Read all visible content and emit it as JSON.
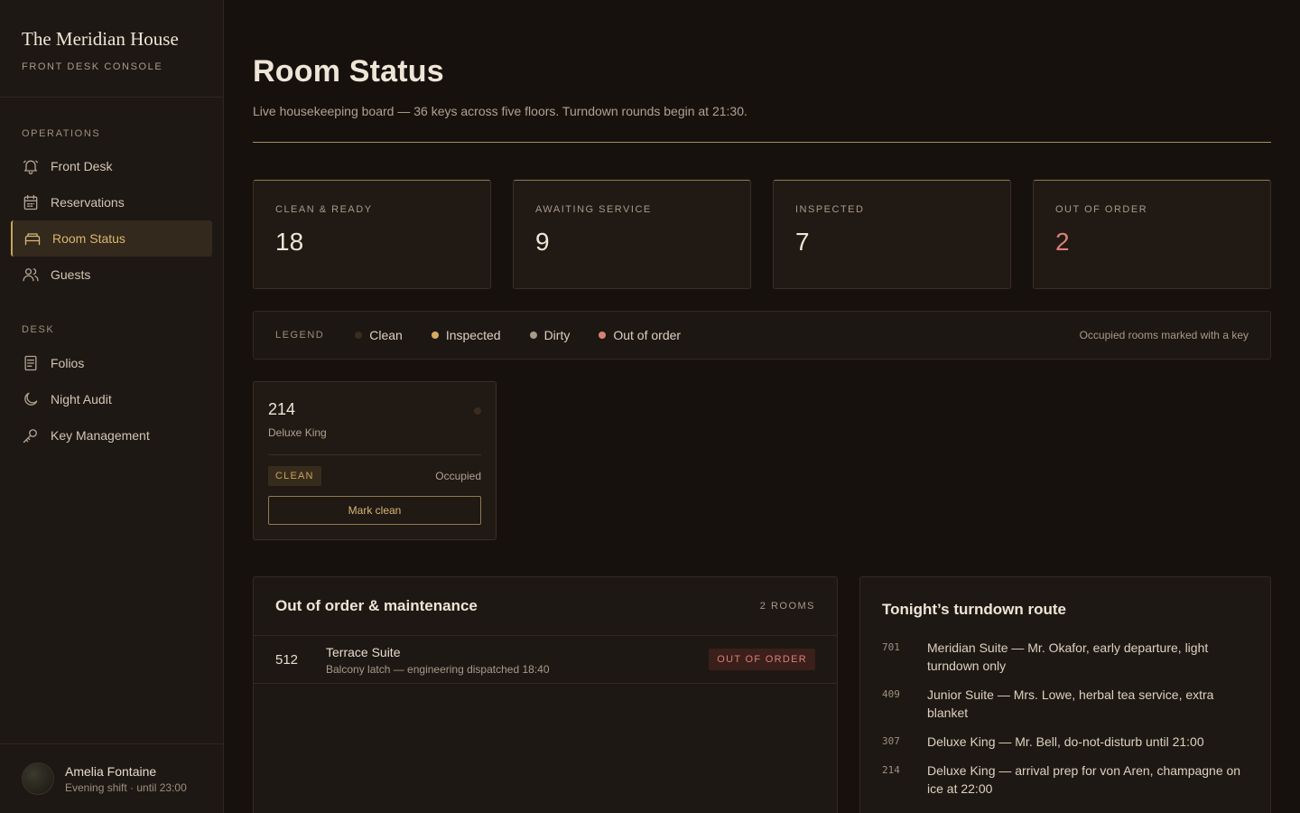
{
  "brand": {
    "name": "The Meridian House",
    "subtitle": "FRONT DESK CONSOLE"
  },
  "nav": {
    "operations_label": "OPERATIONS",
    "desk_label": "DESK",
    "items": [
      {
        "label": "Front Desk",
        "icon": "bell-icon"
      },
      {
        "label": "Reservations",
        "icon": "calendar-icon"
      },
      {
        "label": "Room Status",
        "icon": "bed-icon",
        "active": true
      },
      {
        "label": "Guests",
        "icon": "users-icon"
      },
      {
        "label": "Folios",
        "icon": "document-icon"
      },
      {
        "label": "Night Audit",
        "icon": "moon-icon"
      },
      {
        "label": "Key Management",
        "icon": "key-icon"
      }
    ]
  },
  "user": {
    "name": "Amelia Fontaine",
    "shift": "Evening shift · until 23:00"
  },
  "page": {
    "title": "Room Status",
    "subtitle": "Live housekeeping board — 36 keys across five floors. Turndown rounds begin at 21:30."
  },
  "stats": [
    {
      "label": "CLEAN & READY",
      "value": "18"
    },
    {
      "label": "AWAITING SERVICE",
      "value": "9"
    },
    {
      "label": "INSPECTED",
      "value": "7"
    },
    {
      "label": "OUT OF ORDER",
      "value": "2",
      "color": "#d98075"
    }
  ],
  "legend": {
    "title": "LEGEND",
    "items": [
      {
        "label": "Clean",
        "color": "#3a2c1f"
      },
      {
        "label": "Inspected",
        "color": "#d4ab5e"
      },
      {
        "label": "Dirty",
        "color": "#a89a88"
      },
      {
        "label": "Out of order",
        "color": "#d98075"
      }
    ],
    "note": "Occupied rooms marked with a key"
  },
  "room_card": {
    "number": "214",
    "type": "Deluxe King",
    "status": "CLEAN",
    "occupancy": "Occupied",
    "action": "Mark clean"
  },
  "out_of_order": {
    "title": "Out of order & maintenance",
    "count": "2 ROOMS",
    "rows": [
      {
        "number": "512",
        "name": "Terrace Suite",
        "note": "Balcony latch — engineering dispatched 18:40",
        "badge": "OUT OF ORDER"
      }
    ]
  },
  "turndown": {
    "title": "Tonight’s turndown route",
    "items": [
      {
        "number": "701",
        "text": "Meridian Suite — Mr. Okafor, early departure, light turndown only"
      },
      {
        "number": "409",
        "text": "Junior Suite — Mrs. Lowe, herbal tea service, extra blanket"
      },
      {
        "number": "307",
        "text": "Deluxe King — Mr. Bell, do-not-disturb until 21:00"
      },
      {
        "number": "214",
        "text": "Deluxe King — arrival prep for von Aren, champagne on ice at 22:00"
      }
    ]
  }
}
